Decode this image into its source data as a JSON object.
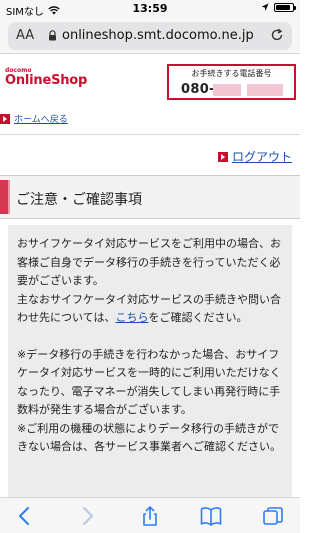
{
  "status_bar": {
    "carrier": "SIMなし",
    "time": "13:59",
    "battery_level": 0.9
  },
  "browser": {
    "text_size_label": "AA",
    "url": "onlineshop.smt.docomo.ne.jp"
  },
  "header": {
    "logo_small": "docomo",
    "logo_big": "OnlineShop",
    "phone_label": "お手続きする電話番号",
    "phone_number_visible": "080-"
  },
  "nav": {
    "back_home": "ホームへ戻る",
    "logout": "ログアウト"
  },
  "notice": {
    "title": "ご注意・ご確認事項",
    "para1": "おサイフケータイ対応サービスをご利用中の場合、お客様ご自身でデータ移行の手続きを行っていただく必要がございます。",
    "para2_before": "主なおサイフケータイ対応サービスの手続きや問い合わせ先については、",
    "para2_link": "こちら",
    "para2_after": "をご確認ください。",
    "para3": "※データ移行の手続きを行わなかった場合、おサイフケータイ対応サービスを一時的にご利用いただけなくなったり、電子マネーが消失してしまい再発行時に手数料が発生する場合がございます。",
    "para4": "※ご利用の機種の状態によりデータ移行の手続きができない場合は、各サービス事業者へご確認ください。"
  }
}
